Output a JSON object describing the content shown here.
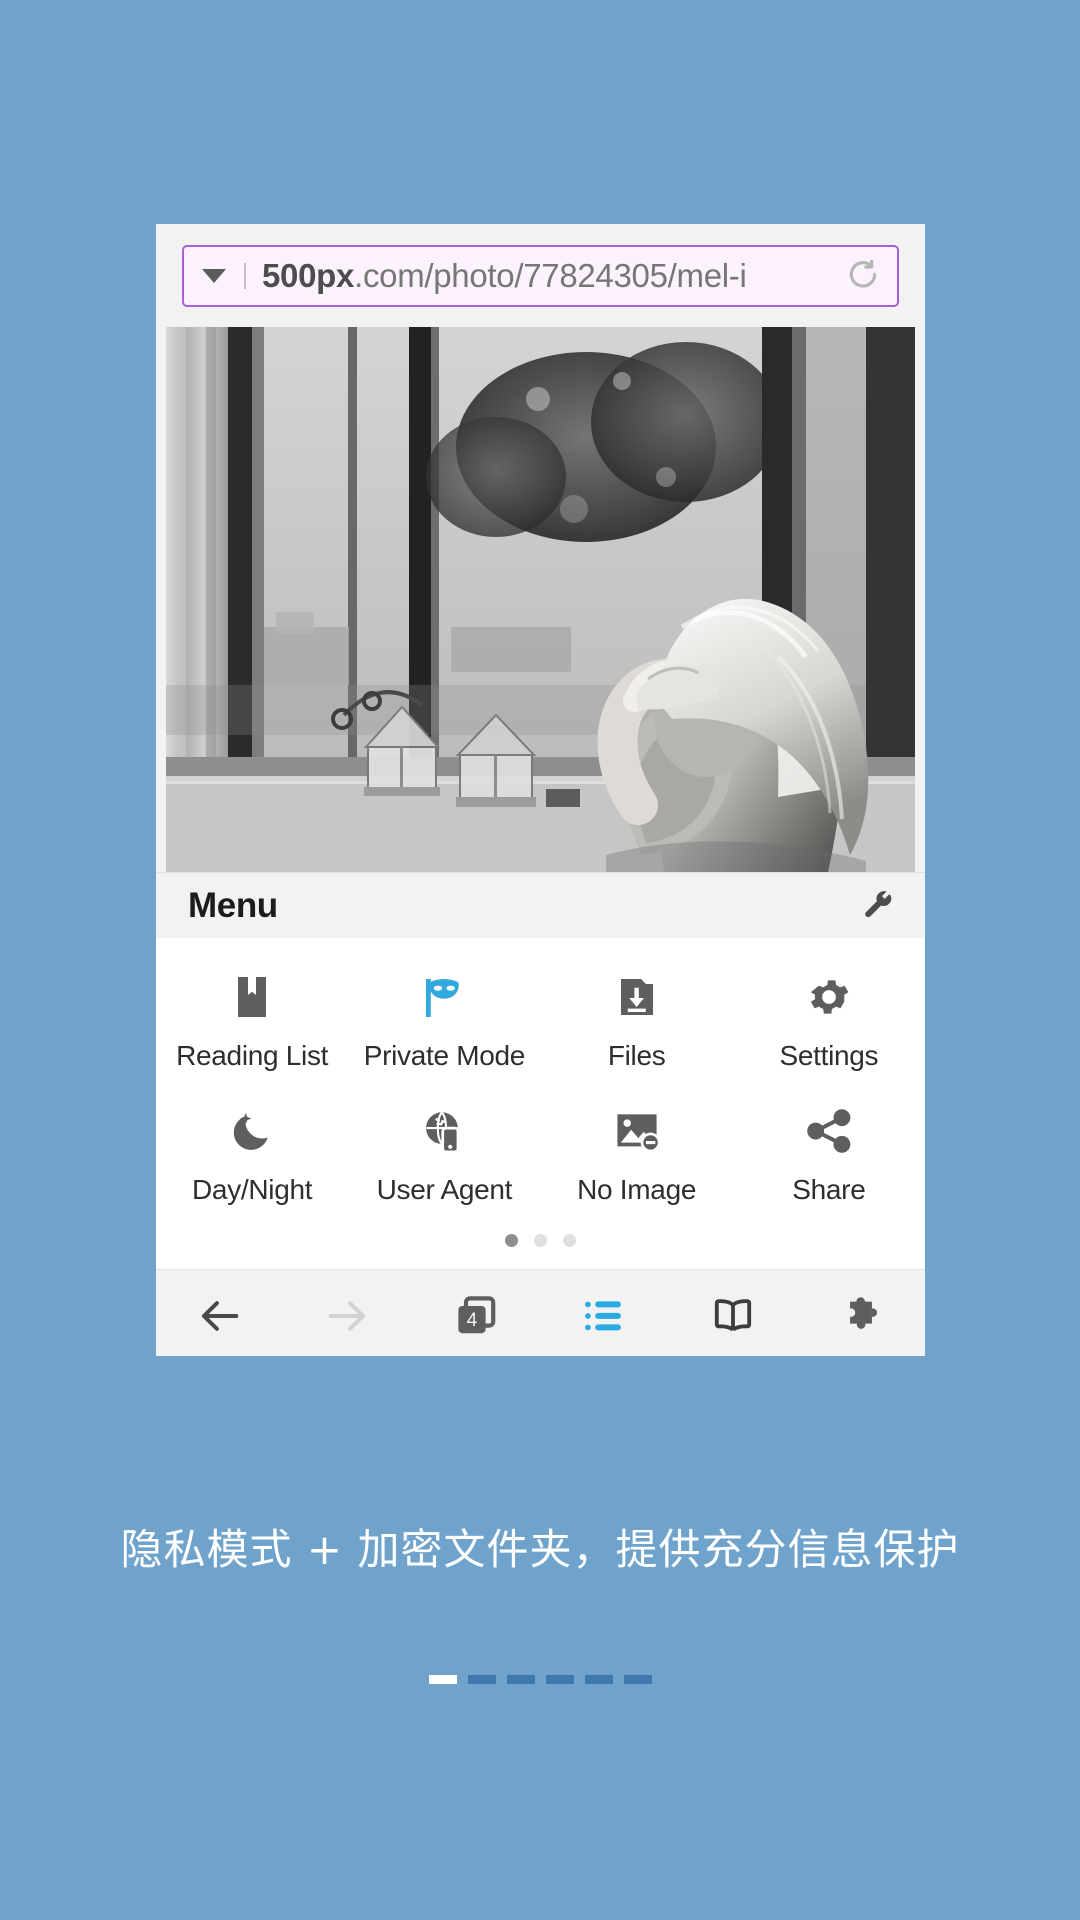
{
  "theme": {
    "background": "#6fa3cb",
    "accent_blue": "#29abe2",
    "url_border": "#ab5fd0",
    "url_background": "#fbf2fd",
    "chrome_background": "#f2f2f2",
    "icon_gray": "#5e5e5e"
  },
  "browser": {
    "urlbar": {
      "dropdown_icon": "chevron-down-icon",
      "url_domain": "500px",
      "url_path": ".com/photo/77824305/mel-i",
      "url_full": "500px.com/photo/77824305/mel-i",
      "reload_icon": "reload-icon"
    },
    "photo": {
      "alt": "black and white photo of a woman sitting on a windowsill",
      "caption_icon": "photo-icon"
    },
    "menu": {
      "title": "Menu",
      "tools_icon": "wrench-icon",
      "items": [
        {
          "label": "Reading List",
          "icon": "bookmark-icon",
          "accent": false
        },
        {
          "label": "Private Mode",
          "icon": "mask-flag-icon",
          "accent": true
        },
        {
          "label": "Files",
          "icon": "folder-download-icon",
          "accent": false
        },
        {
          "label": "Settings",
          "icon": "gear-icon",
          "accent": false
        },
        {
          "label": "Day/Night",
          "icon": "moon-icon",
          "accent": false
        },
        {
          "label": "User Agent",
          "icon": "globe-phone-icon",
          "accent": false
        },
        {
          "label": "No Image",
          "icon": "image-off-icon",
          "accent": false
        },
        {
          "label": "Share",
          "icon": "share-icon",
          "accent": false
        }
      ],
      "page_dots": {
        "count": 3,
        "active_index": 0
      }
    },
    "toolbar": {
      "items": [
        {
          "name": "back-button",
          "icon": "arrow-left-icon",
          "label": "",
          "state": "enabled"
        },
        {
          "name": "forward-button",
          "icon": "arrow-right-icon",
          "label": "",
          "state": "disabled"
        },
        {
          "name": "tabs-button",
          "icon": "tab-stack-icon",
          "label": "4",
          "state": "enabled"
        },
        {
          "name": "bookmarks-button",
          "icon": "list-icon",
          "label": "",
          "state": "active"
        },
        {
          "name": "reader-button",
          "icon": "book-icon",
          "label": "",
          "state": "enabled"
        },
        {
          "name": "extensions-button",
          "icon": "puzzle-icon",
          "label": "",
          "state": "enabled"
        }
      ],
      "tab_count": "4"
    }
  },
  "caption": {
    "text": "隐私模式 + 加密文件夹，提供充分信息保护"
  },
  "page_indicator": {
    "count": 6,
    "active_index": 0
  }
}
